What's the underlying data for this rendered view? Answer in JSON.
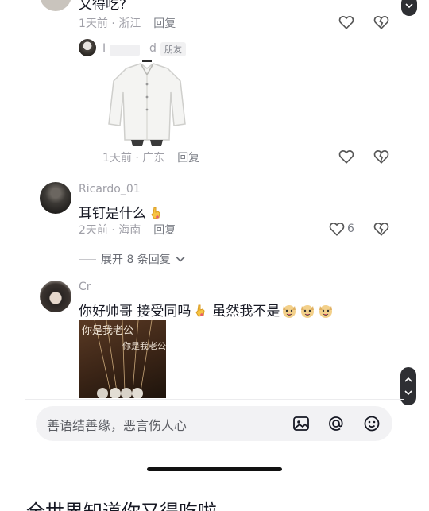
{
  "top_comment": {
    "text_partial": "又得吃?",
    "meta": "1天前 · 浙江",
    "reply_label": "回复"
  },
  "reply_1": {
    "author_partial": "I",
    "author_suffix": "d",
    "friend_tag": "朋友",
    "meta": "1天前 · 广东",
    "reply_label": "回复"
  },
  "comment_2": {
    "username": "Ricardo_01",
    "text": "耳钉是什么",
    "meta": "2天前 · 海南",
    "reply_label": "回复",
    "like_count": "6",
    "expand_label": "展开 8 条回复"
  },
  "comment_3": {
    "username": "Cr",
    "text_a": "你好帅哥 接受同吗",
    "text_b": "虽然我不是",
    "image_caption_1": "你是我老公",
    "image_caption_2": "你是我老公"
  },
  "input": {
    "placeholder": "善语结善缘，恶言伤人心"
  },
  "below_panel": {
    "title": "全世界知道你又得吃啦"
  },
  "colors": {
    "accent_dark": "#2e2f33",
    "meta_gray": "#a0a0a8",
    "input_bg": "#f2f2f4"
  },
  "icons": [
    "heart-icon",
    "dislike-heart-icon",
    "chevron-down-icon",
    "chevron-up-icon",
    "image-icon",
    "at-icon",
    "emoji-icon",
    "hand-emoji-icon",
    "dog-emoji-icon"
  ]
}
